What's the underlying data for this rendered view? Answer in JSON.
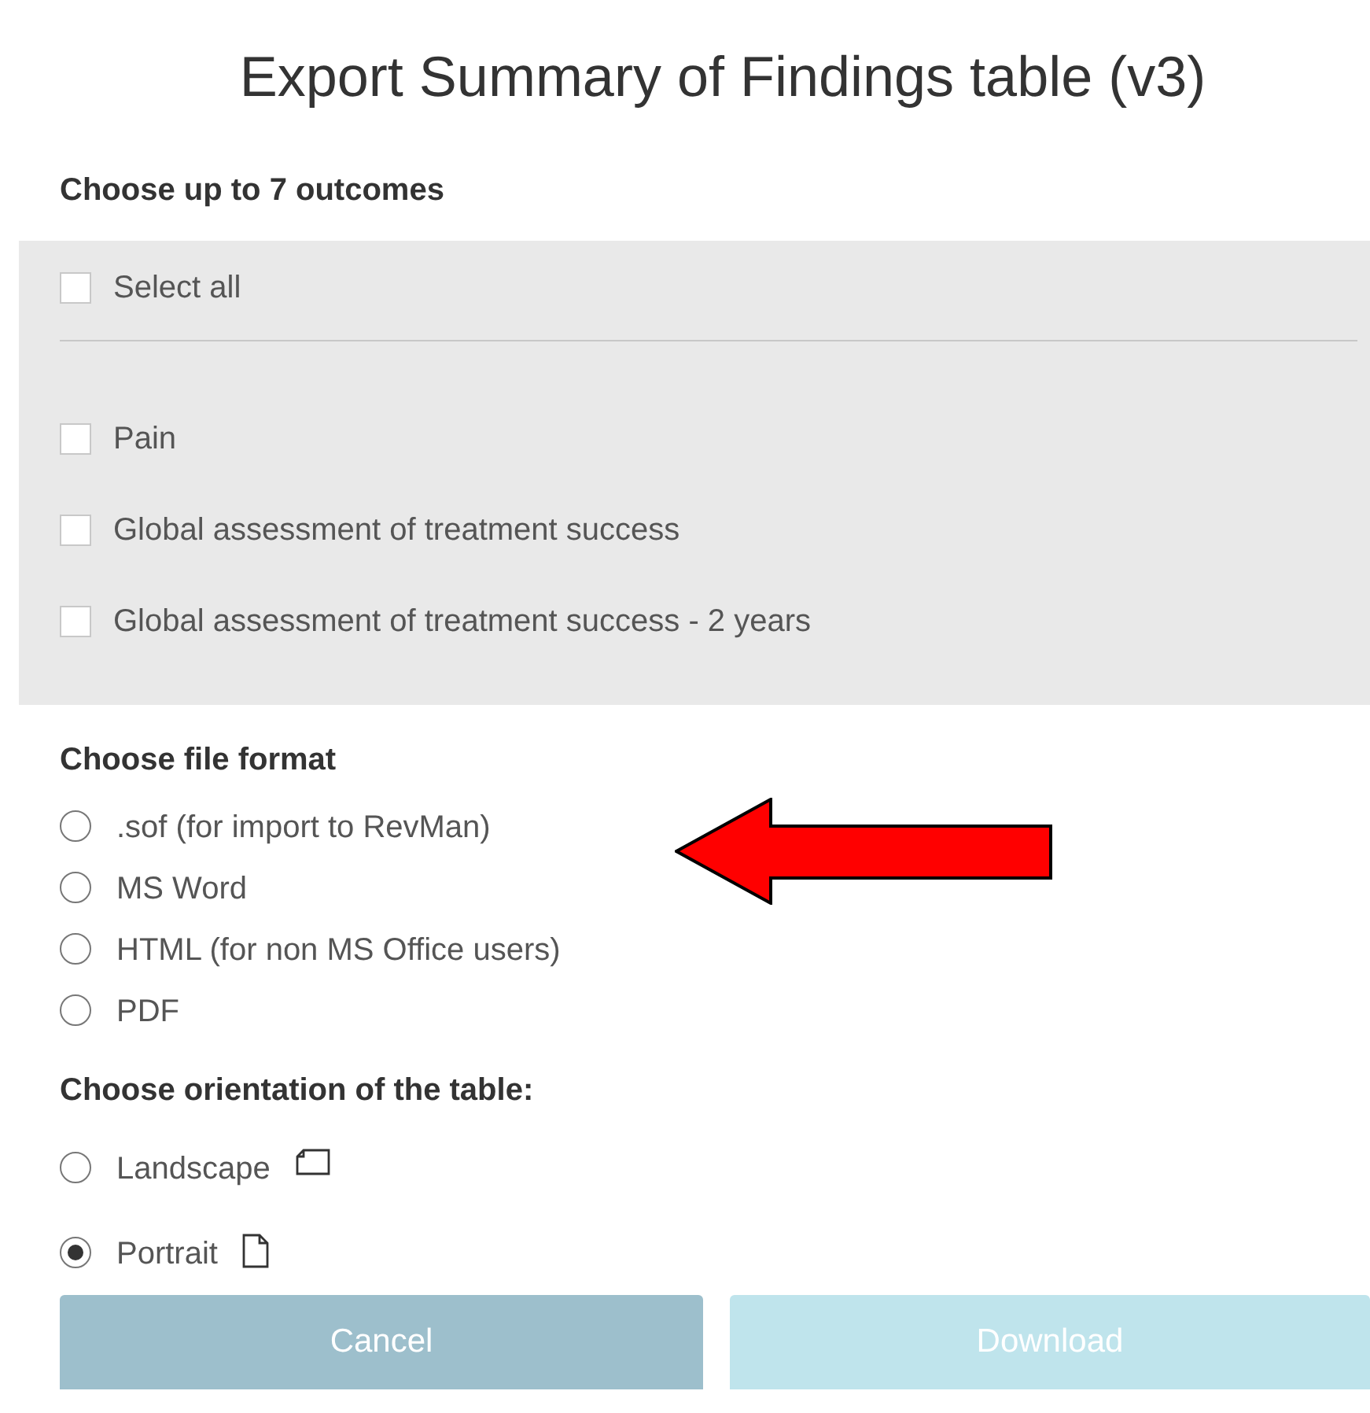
{
  "dialog": {
    "title": "Export Summary of Findings table (v3)"
  },
  "outcomes": {
    "heading": "Choose up to 7 outcomes",
    "select_all": {
      "label": "Select all",
      "checked": false
    },
    "items": [
      {
        "label": "Pain",
        "checked": false
      },
      {
        "label": "Global assessment of treatment success",
        "checked": false
      },
      {
        "label": "Global assessment of treatment success - 2 years",
        "checked": false
      }
    ]
  },
  "file_format": {
    "heading": "Choose file format",
    "options": [
      {
        "label": ".sof (for import to RevMan)",
        "selected": false
      },
      {
        "label": "MS Word",
        "selected": false
      },
      {
        "label": "HTML (for non MS Office users)",
        "selected": false
      },
      {
        "label": "PDF",
        "selected": false
      }
    ]
  },
  "orientation": {
    "heading": "Choose orientation of the table:",
    "options": [
      {
        "label": "Landscape",
        "kind": "landscape",
        "selected": false
      },
      {
        "label": "Portrait",
        "kind": "portrait",
        "selected": true
      }
    ]
  },
  "buttons": [
    {
      "label": "Cancel",
      "kind": "cancel",
      "disabled": false
    },
    {
      "label": "Download",
      "kind": "download",
      "disabled": true
    }
  ]
}
